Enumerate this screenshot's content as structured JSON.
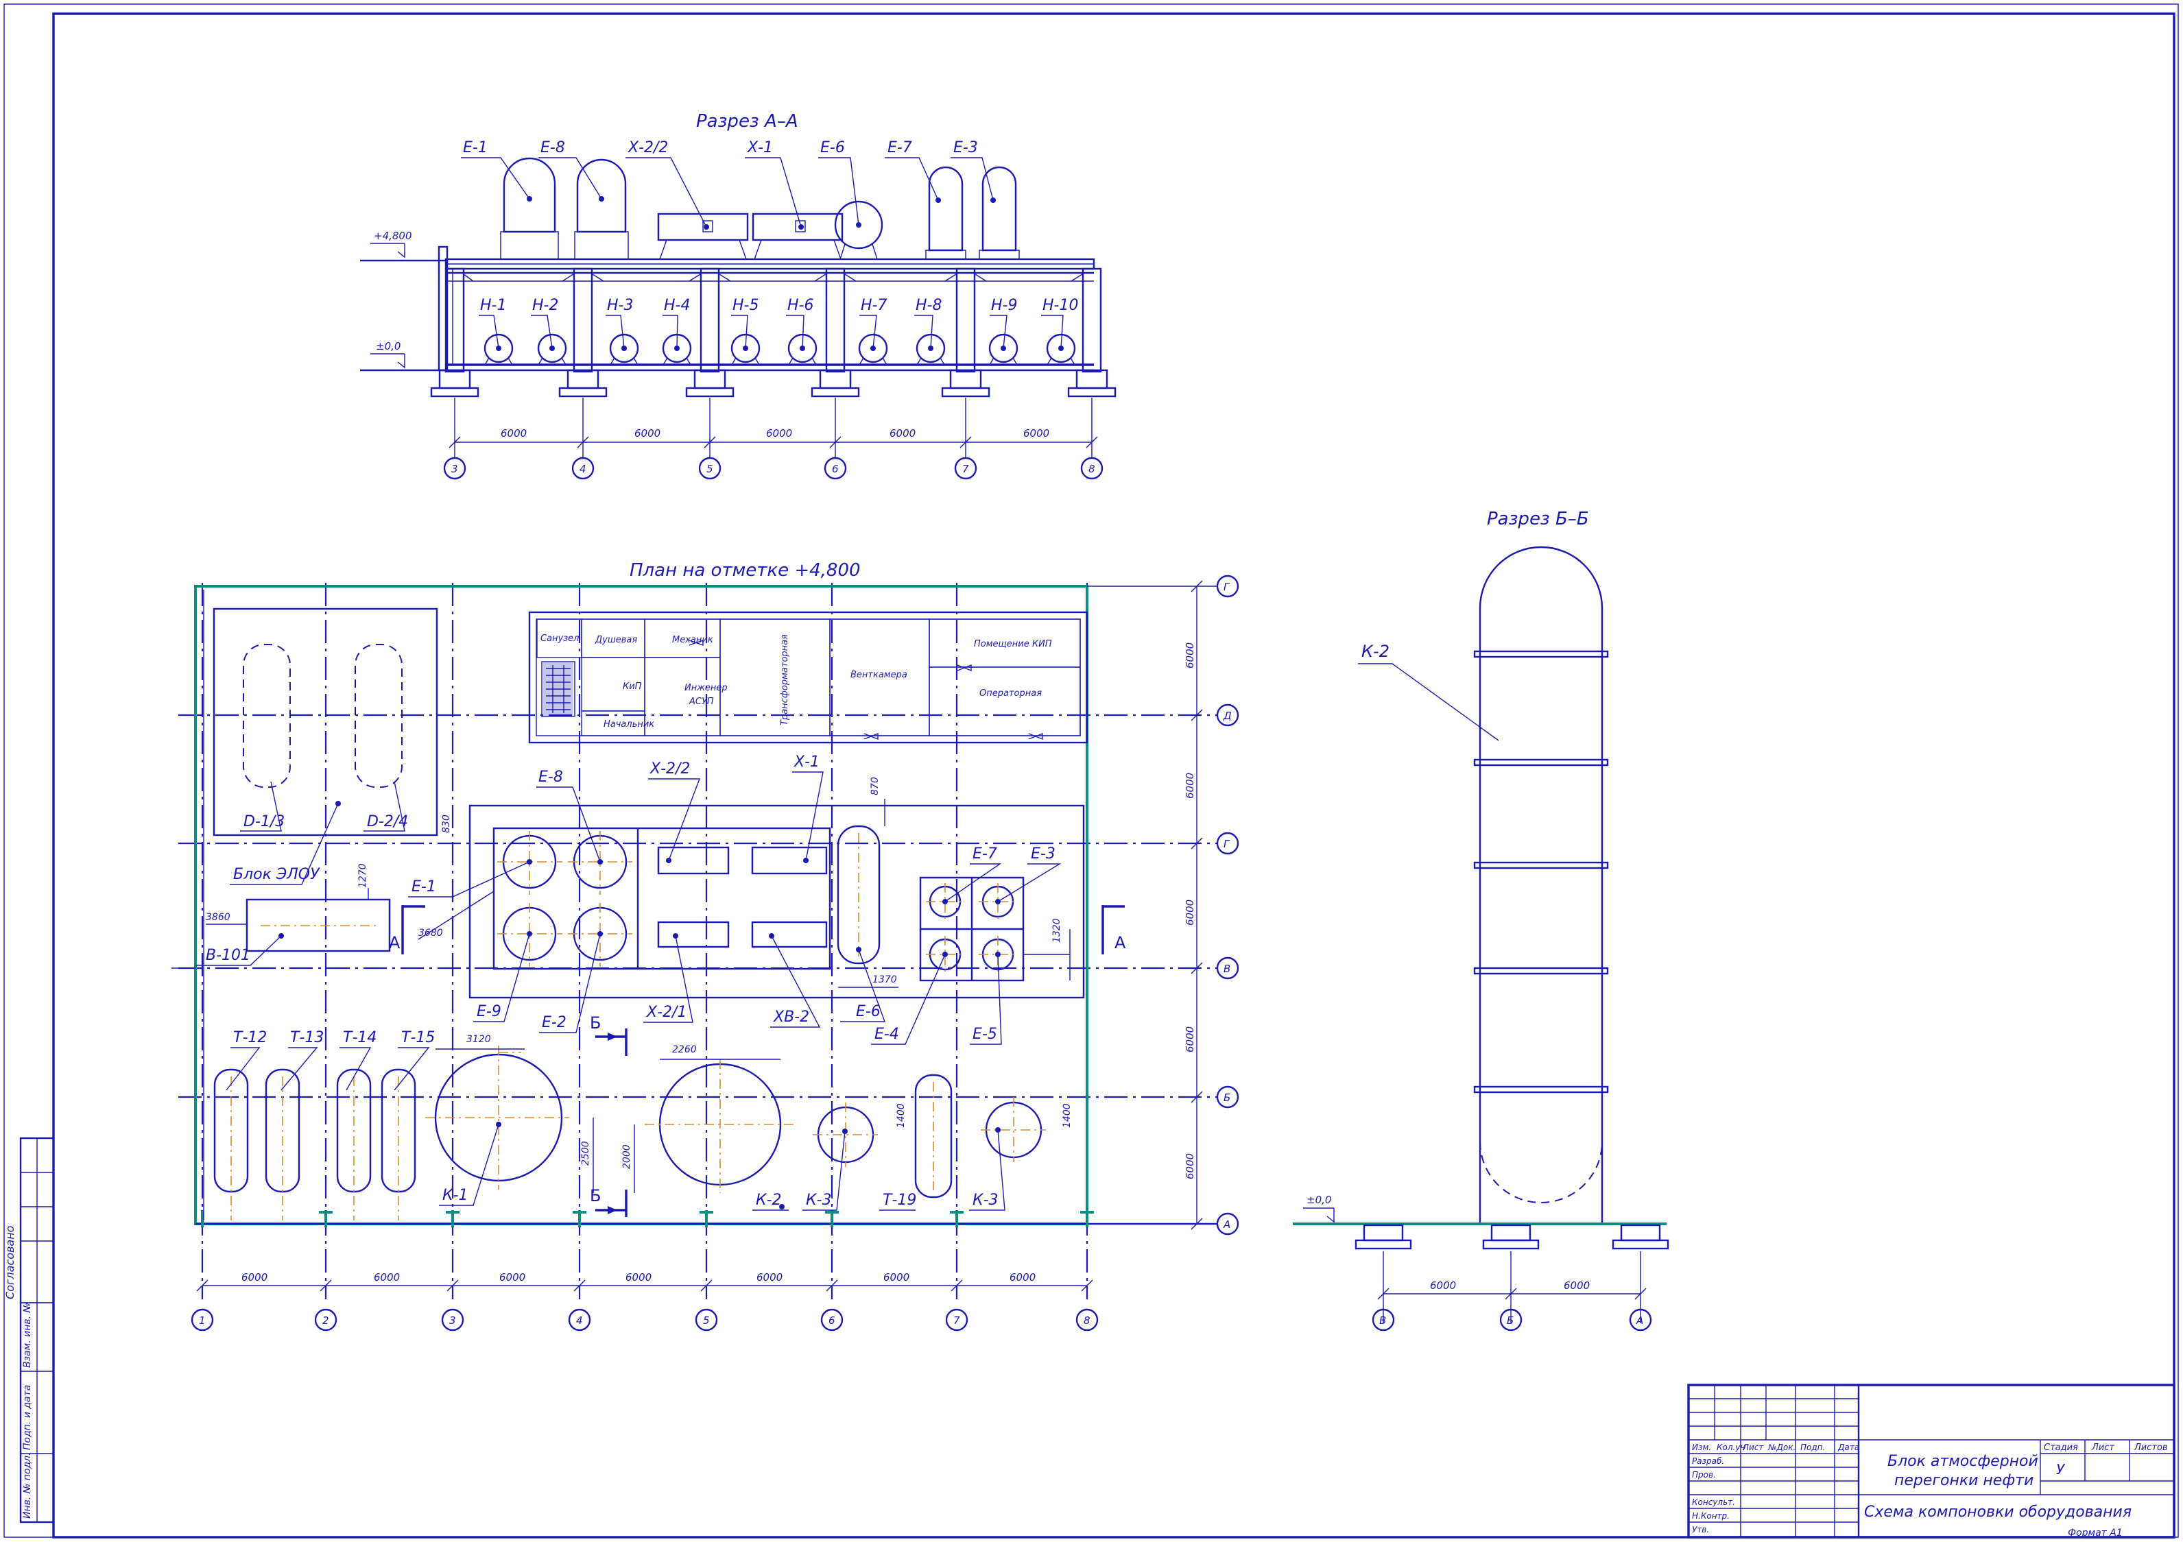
{
  "section_aa": {
    "title": "Разрез А–А",
    "level_top": "+4,800",
    "level_zero": "±0,0",
    "top_labels": [
      "Е-1",
      "Е-8",
      "Х-2/2",
      "Х-1",
      "Е-6",
      "Е-7",
      "Е-3"
    ],
    "pump_labels": [
      "Н-1",
      "Н-2",
      "Н-3",
      "Н-4",
      "Н-5",
      "Н-6",
      "Н-7",
      "Н-8",
      "Н-9",
      "Н-10"
    ],
    "dims": [
      "6000",
      "6000",
      "6000",
      "6000",
      "6000"
    ],
    "axes": [
      "3",
      "4",
      "5",
      "6",
      "7",
      "8"
    ]
  },
  "plan": {
    "title": "План на отметке +4,800",
    "rooms": {
      "sanuzel": "Санузел",
      "dushevaya": "Душевая",
      "mechanic": "Механик",
      "kip": "КиП",
      "engineer_1": "Инженер",
      "engineer_2": "АСУП",
      "chief": "Начальник",
      "transformer": "Трансформаторная",
      "ventkamera": "Венткамера",
      "kip_room": "Помещение КИП",
      "operator": "Операторная"
    },
    "labels": {
      "d13": "D-1/3",
      "d24": "D-2/4",
      "elou": "Блок ЭЛОУ",
      "e1": "Е-1",
      "e8": "Е-8",
      "x22": "Х-2/2",
      "x1": "Х-1",
      "e7": "Е-7",
      "e3": "Е-3",
      "v101": "В-101",
      "e9": "Е-9",
      "e2": "Е-2",
      "x21": "Х-2/1",
      "xv2": "ХВ-2",
      "e6": "Е-6",
      "e4": "Е-4",
      "e5": "Е-5",
      "t12": "Т-12",
      "t13": "Т-13",
      "t14": "Т-14",
      "t15": "Т-15",
      "k1": "К-1",
      "k2": "К-2",
      "k3a": "К-3",
      "t19": "Т-19",
      "k3b": "К-3"
    },
    "section_marks": {
      "a": "А",
      "b": "Б"
    },
    "small_dims": [
      "3860",
      "1270",
      "830",
      "3680",
      "870",
      "1370",
      "1320",
      "3120",
      "2500",
      "2260",
      "2000",
      "1400",
      "1400"
    ],
    "dims_bottom": [
      "6000",
      "6000",
      "6000",
      "6000",
      "6000",
      "6000",
      "6000"
    ],
    "dims_right": [
      "6000",
      "6000",
      "6000",
      "6000",
      "6000"
    ],
    "axes_bottom": [
      "1",
      "2",
      "3",
      "4",
      "5",
      "6",
      "7",
      "8"
    ],
    "axes_right": [
      "Г",
      "Д",
      "Г",
      "В",
      "Б",
      "А"
    ]
  },
  "section_bb": {
    "title": "Разрез Б–Б",
    "label": "К-2",
    "level_zero": "±0,0",
    "dims": [
      "6000",
      "6000"
    ],
    "axes": [
      "В",
      "Б",
      "А"
    ]
  },
  "title_block": {
    "col_headers": [
      "Изм.",
      "Кол.уч",
      "Лист",
      "№Док.",
      "Подп.",
      "Дата"
    ],
    "rows": [
      "Разраб.",
      "Пров.",
      "",
      "Консульт.",
      "Н.Контр.",
      "Утв."
    ],
    "project_1": "Блок атмосферной",
    "project_2": "перегонки нефти",
    "drawing": "Схема компоновки оборудования",
    "stage_h": "Стадия",
    "sheet_h": "Лист",
    "sheets_h": "Листов",
    "stage": "У",
    "format": "Формат А1"
  },
  "side_stamp": [
    "Согласовано",
    "Взам. инв. №",
    "Подп. и дата",
    "Инв. № подл."
  ]
}
